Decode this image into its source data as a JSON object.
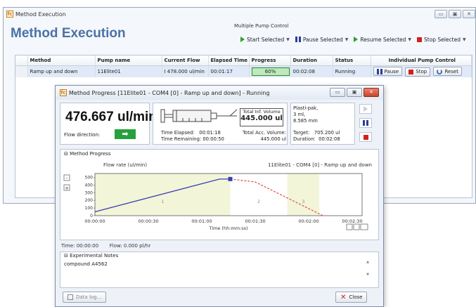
{
  "window": {
    "title": "Method Execution",
    "app_icon": "fc",
    "heading": "Method Execution",
    "controls": [
      "minimize",
      "maximize",
      "close"
    ]
  },
  "multi_pump": {
    "label": "Multiple Pump Control",
    "buttons": [
      {
        "label": "Start Selected",
        "icon": "play-icon"
      },
      {
        "label": "Pause Selected",
        "icon": "pause-icon"
      },
      {
        "label": "Resume Selected",
        "icon": "play-icon"
      },
      {
        "label": "Stop Selected",
        "icon": "stop-icon"
      }
    ]
  },
  "table": {
    "columns": [
      "Method",
      "Pump name",
      "Current Flow",
      "Elapsed Time",
      "Progress",
      "Duration",
      "Status",
      "Individual Pump Control"
    ],
    "rows": [
      {
        "method": "Ramp up and down",
        "pump": "11Elite01",
        "flow": "I 478.000 ul/min",
        "elapsed": "00:01:17",
        "progress": "60%",
        "duration": "00:02:08",
        "status": "Running",
        "actions": [
          "Pause",
          "Stop",
          "Reset"
        ]
      }
    ]
  },
  "dialog": {
    "title": "Method Progress [11Elite01 - COM4 [0] - Ramp up and down] - Running",
    "flow_value": "476.667 ul/min",
    "flow_direction_label": "Flow direction:",
    "total_inf_label": "Total Inf. Volume",
    "total_inf_value": "445.000 ul",
    "time_elapsed_label": "Time Elapsed:",
    "time_elapsed": "00:01:18",
    "time_remaining_label": "Time Remaining:",
    "time_remaining": "00:00:50",
    "total_acc_label": "Total Acc. Volume:",
    "total_acc_value": "445.000 ul",
    "syringe_info": [
      "Plasti-pak,",
      "3 ml,",
      "8.585 mm"
    ],
    "target_label": "Target:",
    "target_value": "705.200 ul",
    "duration_label": "Duration:",
    "duration_value": "00:02:08",
    "method_progress_label": "Method Progress",
    "status_time": "Time: 00:00:00",
    "status_flow": "Flow: 0.000 pl/hr",
    "notes_label": "Experimental Notes",
    "notes_text": "compound A4562",
    "data_log_label": "Data log...",
    "close_label": "Close"
  },
  "chart_data": {
    "type": "line",
    "title_left": "Flow rate (ul/min)",
    "title_right": "11Elite01 - COM4 [0] - Ramp up and down",
    "xlabel": "Time (hh:mm:ss)",
    "x_ticks": [
      "00:00:00",
      "00:00:30",
      "00:01:00",
      "00:01:30",
      "00:02:00",
      "00:02:30"
    ],
    "y_ticks": [
      0,
      100,
      200,
      300,
      400,
      500
    ],
    "ylim": [
      0,
      550
    ],
    "xlim": [
      0,
      150
    ],
    "phase_labels": [
      "1",
      "2",
      "3"
    ],
    "series": [
      {
        "values_x": [
          0,
          70,
          76
        ],
        "values_y": [
          50,
          478,
          478
        ]
      },
      {
        "values_x": [
          76,
          90,
          128
        ],
        "values_y": [
          478,
          440,
          0
        ]
      }
    ]
  }
}
